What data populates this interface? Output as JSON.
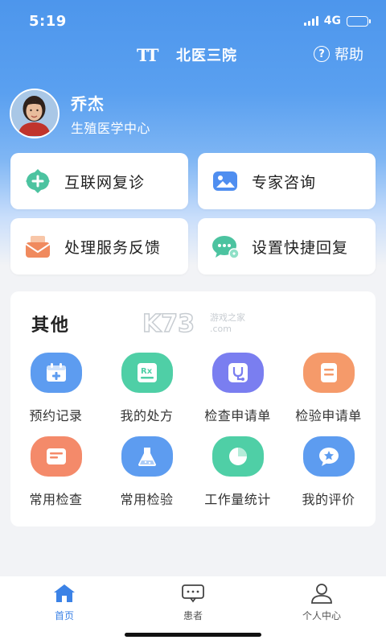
{
  "status_bar": {
    "time": "5:19",
    "network": "4G"
  },
  "header": {
    "title": "北医三院",
    "help_label": "帮助",
    "font_size_icon": "TT"
  },
  "profile": {
    "name": "乔杰",
    "department": "生殖医学中心"
  },
  "quick_actions": [
    {
      "label": "互联网复诊",
      "icon": "plus-circle-icon"
    },
    {
      "label": "专家咨询",
      "icon": "image-chat-icon"
    },
    {
      "label": "处理服务反馈",
      "icon": "envelope-icon"
    },
    {
      "label": "设置快捷回复",
      "icon": "chat-bubble-icon"
    }
  ],
  "other": {
    "title": "其他",
    "watermark": "K73 游戏之家 .com",
    "items": [
      {
        "label": "预约记录",
        "icon": "calendar-plus-icon",
        "color": "#5d9cf0"
      },
      {
        "label": "我的处方",
        "icon": "prescription-icon",
        "color": "#4fcfa6"
      },
      {
        "label": "检查申请单",
        "icon": "stethoscope-icon",
        "color": "#7a7ef0"
      },
      {
        "label": "检验申请单",
        "icon": "document-icon",
        "color": "#f59a6a"
      },
      {
        "label": "常用检查",
        "icon": "clipboard-icon",
        "color": "#f48a6a"
      },
      {
        "label": "常用检验",
        "icon": "flask-icon",
        "color": "#5d9cf0"
      },
      {
        "label": "工作量统计",
        "icon": "pie-chart-icon",
        "color": "#4fcfa6"
      },
      {
        "label": "我的评价",
        "icon": "star-bubble-icon",
        "color": "#5d9cf0"
      }
    ]
  },
  "tabbar": [
    {
      "label": "首页",
      "icon": "home-icon",
      "active": true
    },
    {
      "label": "患者",
      "icon": "patient-chat-icon",
      "active": false
    },
    {
      "label": "个人中心",
      "icon": "user-icon",
      "active": false
    }
  ],
  "colors": {
    "brand_blue": "#4d96ec",
    "active_tab": "#3b82e6",
    "background": "#f2f3f6"
  }
}
